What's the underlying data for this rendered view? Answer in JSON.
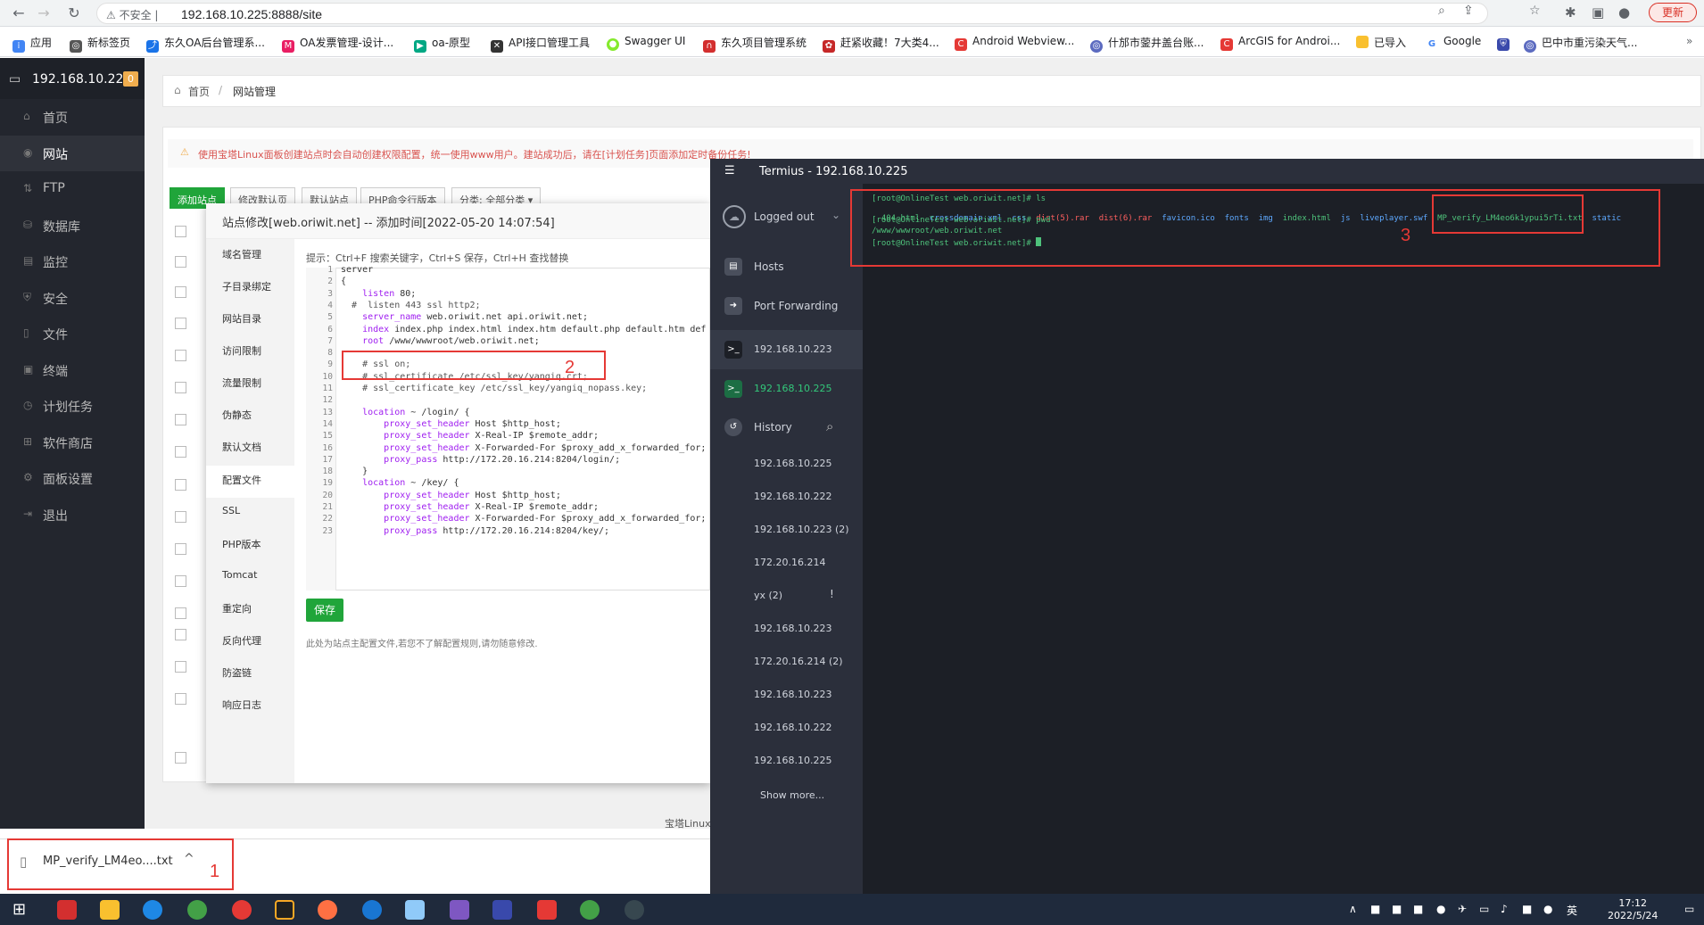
{
  "browser": {
    "not_secure_label": "不安全",
    "url": "192.168.10.225:8888/site",
    "update_label": "更新",
    "bookmarks": [
      "应用",
      "新标签页",
      "东久OA后台管理系...",
      "OA发票管理-设计...",
      "oa-原型",
      "API接口管理工具",
      "Swagger UI",
      "东久项目管理系统",
      "赶紧收藏！7大类4...",
      "Android Webview...",
      "什邡市蓥井盖台账...",
      "ArcGIS for Androi...",
      "已导入",
      "Google",
      "巴中市重污染天气..."
    ]
  },
  "panel": {
    "server_ip": "192.168.10.225",
    "badge_count": "0",
    "sidebar": [
      "首页",
      "网站",
      "FTP",
      "数据库",
      "监控",
      "安全",
      "文件",
      "终端",
      "计划任务",
      "软件商店",
      "面板设置",
      "退出"
    ],
    "breadcrumb_home": "首页",
    "breadcrumb_current": "网站管理",
    "alert_text": "使用宝塔Linux面板创建站点时会自动创建权限配置，统一使用www用户。建站成功后，请在[计划任务]页面添加定时备份任务!",
    "toolbar": [
      "添加站点",
      "修改默认页",
      "默认站点",
      "PHP命令行版本",
      "分类: 全部分类"
    ],
    "footer_text": "宝塔Linux"
  },
  "modal": {
    "title": "站点修改[web.oriwit.net] -- 添加时间[2022-05-20 14:07:54]",
    "nav": [
      "域名管理",
      "子目录绑定",
      "网站目录",
      "访问限制",
      "流量限制",
      "伪静态",
      "默认文档",
      "配置文件",
      "SSL",
      "PHP版本",
      "Tomcat",
      "重定向",
      "反向代理",
      "防盗链",
      "响应日志"
    ],
    "hint": "提示：Ctrl+F 搜索关键字，Ctrl+S 保存，Ctrl+H 查找替换",
    "code_lines": [
      "server",
      "{",
      "    listen 80;",
      "  #  listen 443 ssl http2;",
      "    server_name web.oriwit.net api.oriwit.net;",
      "    index index.php index.html index.htm default.php default.htm default",
      "    root /www/wwwroot/web.oriwit.net;",
      "",
      "    # ssl on;",
      "    # ssl_certificate /etc/ssl_key/yangiq.crt;",
      "    # ssl_certificate_key /etc/ssl_key/yangiq_nopass.key;",
      "",
      "    location ~ /login/ {",
      "        proxy_set_header Host $http_host;",
      "        proxy_set_header X-Real-IP $remote_addr;",
      "        proxy_set_header X-Forwarded-For $proxy_add_x_forwarded_for;",
      "        proxy_pass http://172.20.16.214:8204/login/;",
      "    }",
      "    location ~ /key/ {",
      "        proxy_set_header Host $http_host;",
      "        proxy_set_header X-Real-IP $remote_addr;",
      "        proxy_set_header X-Forwarded-For $proxy_add_x_forwarded_for;",
      "        proxy_pass http://172.20.16.214:8204/key/;"
    ],
    "save_label": "保存",
    "save_note": "此处为站点主配置文件,若您不了解配置规则,请勿随意修改."
  },
  "termius": {
    "title": "Termius - 192.168.10.225",
    "status": "Logged out",
    "nav": [
      "Hosts",
      "Port Forwarding",
      "192.168.10.223",
      "192.168.10.225"
    ],
    "history_label": "History",
    "history": [
      "192.168.10.225",
      "192.168.10.222",
      "192.168.10.223 (2)",
      "172.20.16.214",
      "yx (2)",
      "192.168.10.223",
      "172.20.16.214 (2)",
      "192.168.10.223",
      "192.168.10.222",
      "192.168.10.225"
    ],
    "show_more": "Show more...",
    "term": {
      "prompt1": "[root@OnlineTest web.oriwit.net]# ls",
      "files": [
        "404.html",
        "crossdomain.xml",
        "css",
        "dist(5).rar",
        "dist(6).rar",
        "favicon.ico",
        "fonts",
        "img",
        "index.html",
        "js",
        "liveplayer.swf",
        "MP_verify_LM4eo6k1ypui5rTi.txt",
        "static"
      ],
      "prompt2": "[root@OnlineTest web.oriwit.net]# pwd",
      "pwd": "/www/wwwroot/web.oriwit.net",
      "prompt3": "[root@OnlineTest web.oriwit.net]# "
    }
  },
  "annotations": [
    "1",
    "2",
    "3"
  ],
  "download": {
    "filename": "MP_verify_LM4eo....txt"
  },
  "taskbar": {
    "time": "17:12",
    "date": "2022/5/24",
    "ime": "英"
  }
}
